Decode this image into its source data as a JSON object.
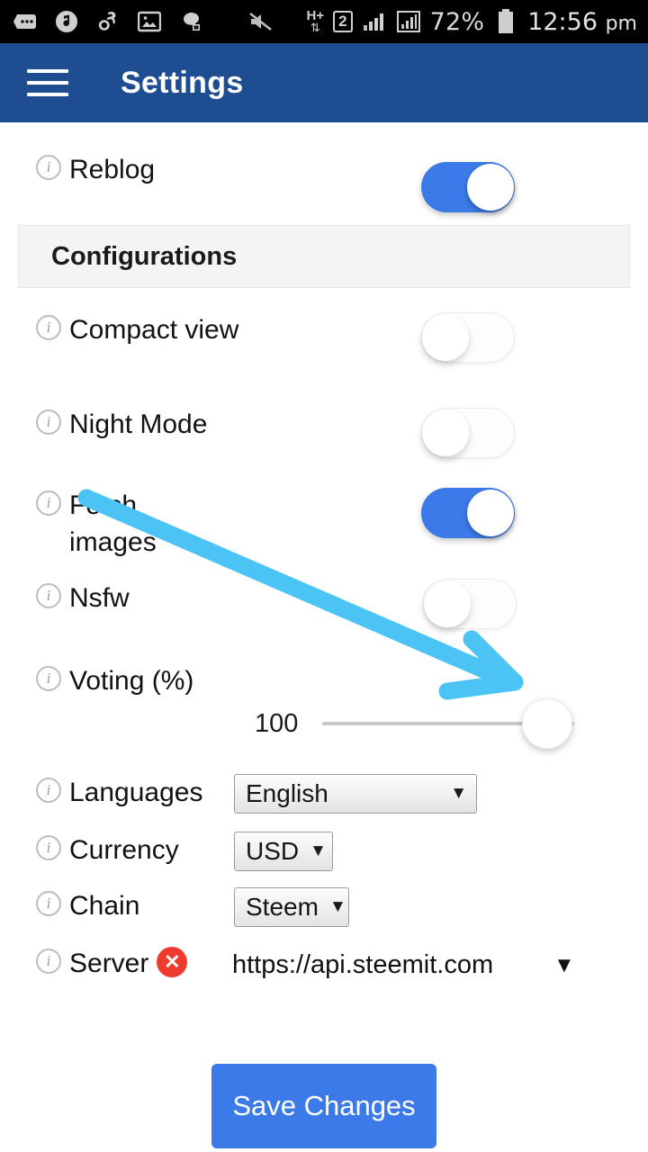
{
  "status_bar": {
    "icons": [
      "messages-icon",
      "music-icon",
      "uc-browser-icon",
      "gallery-icon",
      "app-icon",
      "mute-icon"
    ],
    "network_type": "H+",
    "sim_slot": "2",
    "battery_percent": "72%",
    "time": "12:56",
    "ampm": "pm"
  },
  "app_bar": {
    "menu_icon": "hamburger-icon",
    "title": "Settings"
  },
  "settings": {
    "reblog": {
      "label": "Reblog",
      "info_icon": "info-icon",
      "state": "on"
    },
    "section_title": "Configurations",
    "compact_view": {
      "label": "Compact view",
      "info_icon": "info-icon",
      "state": "off"
    },
    "night_mode": {
      "label": "Night Mode",
      "info_icon": "info-icon",
      "state": "off"
    },
    "fetch_images": {
      "label": "Fetch images",
      "info_icon": "info-icon",
      "state": "on"
    },
    "nsfw": {
      "label": "Nsfw",
      "info_icon": "info-icon",
      "state": "off"
    },
    "voting": {
      "label": "Voting (%)",
      "info_icon": "info-icon",
      "value": "100",
      "min": "0",
      "max": "100"
    },
    "languages": {
      "label": "Languages",
      "info_icon": "info-icon",
      "value": "English",
      "caret": "▼"
    },
    "currency": {
      "label": "Currency",
      "info_icon": "info-icon",
      "value": "USD",
      "caret": "▼"
    },
    "chain": {
      "label": "Chain",
      "info_icon": "info-icon",
      "value": "Steem",
      "caret": "▼"
    },
    "server": {
      "label": "Server",
      "info_icon": "info-icon",
      "status_icon": "error-circle-icon",
      "status_glyph": "✕",
      "value": "https://api.steemit.com",
      "caret": "▼"
    }
  },
  "actions": {
    "save_label": "Save Changes"
  },
  "annotation": {
    "type": "arrow",
    "color": "#4BC4F5",
    "points_to": "voting-slider-thumb"
  },
  "colors": {
    "app_bar": "#1e4d91",
    "accent": "#3b7ae8",
    "status_bar": "#000000",
    "section_bg": "#f4f4f4",
    "error": "#ef3b2d",
    "annotation": "#4BC4F5"
  }
}
